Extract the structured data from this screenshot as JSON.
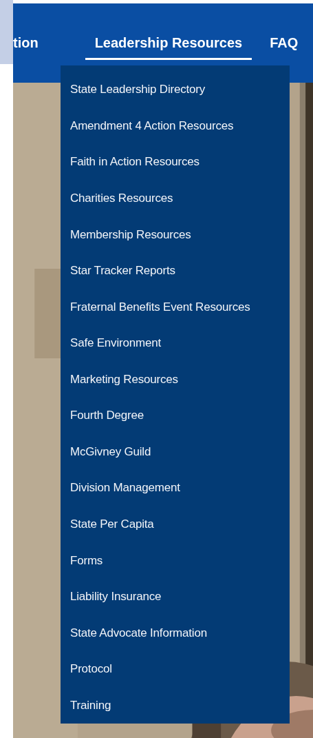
{
  "nav": {
    "items": [
      {
        "label": "tion",
        "selected": false
      },
      {
        "label": "Leadership Resources",
        "selected": true
      },
      {
        "label": "FAQ",
        "selected": false
      }
    ]
  },
  "dropdown": {
    "items": [
      "State Leadership Directory",
      "Amendment 4 Action Resources",
      "Faith in Action Resources",
      "Charities Resources",
      "Membership Resources",
      "Star Tracker Reports",
      "Fraternal Benefits Event Resources",
      "Safe Environment",
      "Marketing Resources",
      "Fourth Degree",
      "McGivney Guild",
      "Division Management",
      "State Per Capita",
      "Forms",
      "Liability Insurance",
      "State Advocate Information",
      "Protocol",
      "Training"
    ]
  }
}
